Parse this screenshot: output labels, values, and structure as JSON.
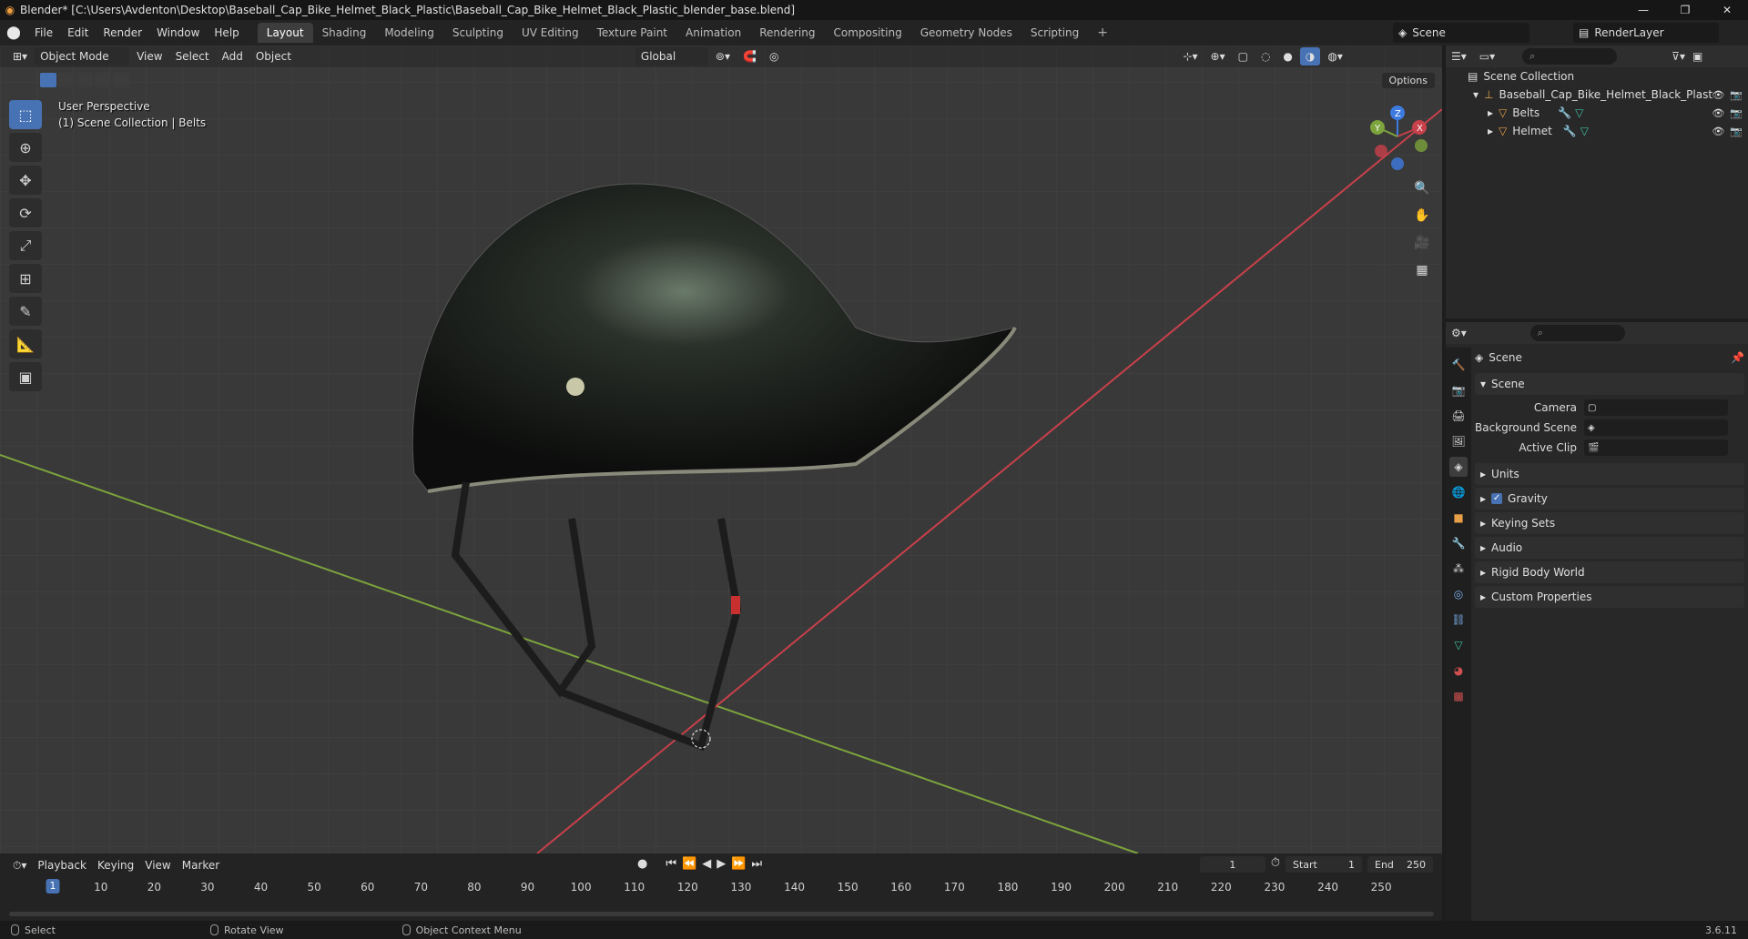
{
  "window": {
    "title": "Blender* [C:\\Users\\Avdenton\\Desktop\\Baseball_Cap_Bike_Helmet_Black_Plastic\\Baseball_Cap_Bike_Helmet_Black_Plastic_blender_base.blend]",
    "controls": [
      "—",
      "❐",
      "✕"
    ]
  },
  "menubar": {
    "menus": [
      "File",
      "Edit",
      "Render",
      "Window",
      "Help"
    ],
    "workspaces": [
      "Layout",
      "Shading",
      "Modeling",
      "Sculpting",
      "UV Editing",
      "Texture Paint",
      "Animation",
      "Rendering",
      "Compositing",
      "Geometry Nodes",
      "Scripting"
    ],
    "active_workspace": "Layout",
    "add_tab": "+",
    "scene": "Scene",
    "view_layer": "RenderLayer"
  },
  "viewport": {
    "mode": "Object Mode",
    "menus": [
      "View",
      "Select",
      "Add",
      "Object"
    ],
    "orientation": "Global",
    "perspective_label": "User Perspective",
    "collection_label": "(1) Scene Collection | Belts",
    "options_label": "Options",
    "gizmo_axes": [
      "X",
      "Y",
      "Z"
    ]
  },
  "outliner": {
    "search_placeholder": "",
    "root": "Scene Collection",
    "collection": "Baseball_Cap_Bike_Helmet_Black_Plast",
    "objects": [
      "Belts",
      "Helmet"
    ]
  },
  "properties": {
    "context_title": "Scene",
    "panel_scene": "Scene",
    "fields": [
      {
        "label": "Camera",
        "value": ""
      },
      {
        "label": "Background Scene",
        "value": ""
      },
      {
        "label": "Active Clip",
        "value": ""
      }
    ],
    "panels": [
      "Units",
      "Gravity",
      "Keying Sets",
      "Audio",
      "Rigid Body World",
      "Custom Properties"
    ],
    "gravity_checked": true
  },
  "timeline": {
    "menus": [
      "Playback",
      "Keying",
      "View",
      "Marker"
    ],
    "current_frame": "1",
    "start_label": "Start",
    "start": "1",
    "end_label": "End",
    "end": "250",
    "ruler_ticks": [
      "10",
      "20",
      "30",
      "40",
      "50",
      "60",
      "70",
      "80",
      "90",
      "100",
      "110",
      "120",
      "130",
      "140",
      "150",
      "160",
      "170",
      "180",
      "190",
      "200",
      "210",
      "220",
      "230",
      "240",
      "250"
    ],
    "ruler_current": "1"
  },
  "statusbar": {
    "select": "Select",
    "rotate": "Rotate View",
    "context_menu": "Object Context Menu",
    "version": "3.6.11"
  },
  "colors": {
    "accent": "#4772b3",
    "x_axis": "#c8404a",
    "y_axis": "#7ca33c",
    "z_axis": "#3d7be0"
  }
}
